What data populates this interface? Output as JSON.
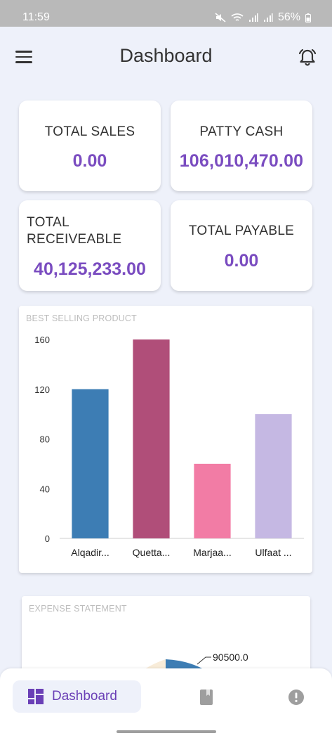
{
  "status_bar": {
    "time": "11:59",
    "battery": "56%"
  },
  "header": {
    "title": "Dashboard"
  },
  "stats": {
    "total_sales": {
      "label": "TOTAL SALES",
      "value": "0.00"
    },
    "patty_cash": {
      "label": "PATTY CASH",
      "value": "106,010,470.00"
    },
    "total_receivable": {
      "label": "TOTAL RECEIVEABLE",
      "value": "40,125,233.00"
    },
    "total_payable": {
      "label": "TOTAL PAYABLE",
      "value": "0.00"
    }
  },
  "best_selling": {
    "title": "BEST SELLING PRODUCT"
  },
  "chart_data": {
    "type": "bar",
    "title": "BEST SELLING PRODUCT",
    "categories": [
      "Alqadir...",
      "Quetta...",
      "Marjaa...",
      "Ulfaat ..."
    ],
    "values": [
      120,
      160,
      60,
      100
    ],
    "colors": [
      "#3d7db4",
      "#b04e79",
      "#f27ca5",
      "#c5b8e3"
    ],
    "ylim": [
      0,
      160
    ],
    "yticks": [
      0,
      40,
      80,
      120,
      160
    ],
    "xlabel": "",
    "ylabel": "",
    "grid": false
  },
  "expense": {
    "title": "EXPENSE STATEMENT",
    "value_label": "90500.0",
    "colors": {
      "slice": "#3d7db4",
      "other": "#f8ecd9"
    }
  },
  "bottom_nav": {
    "dashboard_label": "Dashboard",
    "book_icon": "book-icon",
    "alert_icon": "alert-circle-icon"
  },
  "colors": {
    "accent": "#7a4cc0",
    "background": "#eef1fa",
    "status_bar": "#b9b9b9"
  }
}
